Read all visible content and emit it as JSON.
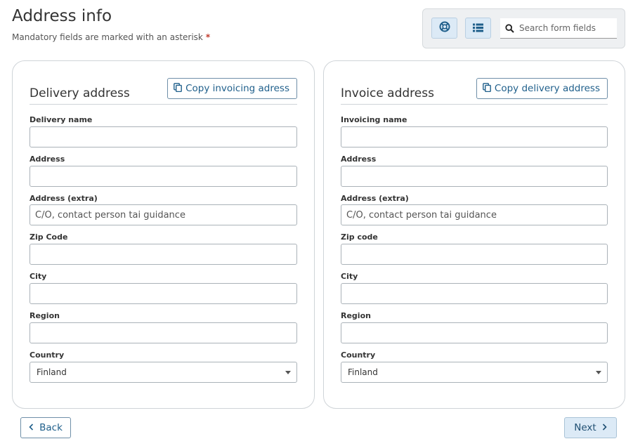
{
  "header": {
    "title": "Address info",
    "subtitle": "Mandatory fields are marked with an asterisk",
    "asterisk": "*"
  },
  "toolbar": {
    "help_icon": "lifebuoy-icon",
    "list_icon": "list-icon",
    "search_icon": "search-icon",
    "search_placeholder": "Search form fields"
  },
  "delivery": {
    "title": "Delivery address",
    "copy_label": "Copy invoicing adress",
    "fields": {
      "name_label": "Delivery name",
      "address_label": "Address",
      "address_extra_label": "Address (extra)",
      "address_extra_placeholder": "C/O, contact person tai guidance",
      "zip_label": "Zip Code",
      "city_label": "City",
      "region_label": "Region",
      "country_label": "Country",
      "country_value": "Finland"
    }
  },
  "invoice": {
    "title": "Invoice address",
    "copy_label": "Copy delivery address",
    "fields": {
      "name_label": "Invoicing name",
      "address_label": "Address",
      "address_extra_label": "Address (extra)",
      "address_extra_placeholder": "C/O, contact person tai guidance",
      "zip_label": "Zip code",
      "city_label": "City",
      "region_label": "Region",
      "country_label": "Country",
      "country_value": "Finland"
    }
  },
  "nav": {
    "back_label": "Back",
    "next_label": "Next"
  },
  "colors": {
    "accent": "#1f5f8b",
    "asterisk": "#c0392b",
    "button_fill": "#dceaf6"
  }
}
